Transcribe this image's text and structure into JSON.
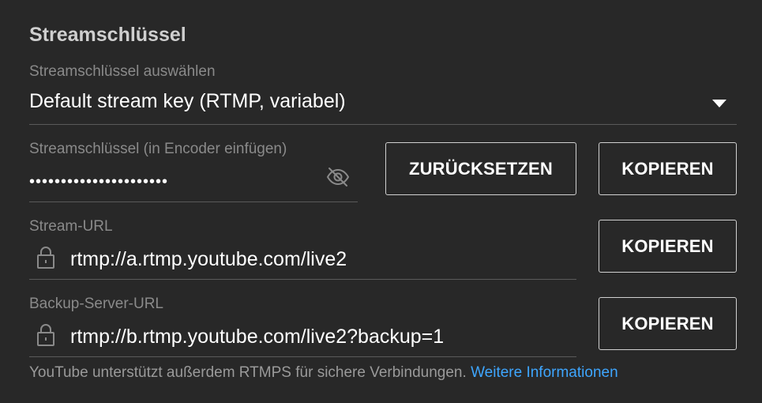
{
  "section": {
    "title": "Streamschlüssel"
  },
  "key_select": {
    "label": "Streamschlüssel auswählen",
    "value": "Default stream key (RTMP, variabel)",
    "dropdown_icon": "caret-down-icon"
  },
  "stream_key": {
    "label": "Streamschlüssel (in Encoder einfügen)",
    "masked_value": "••••••••••••••••••••••",
    "visibility_icon": "eye-off-icon",
    "reset_label": "ZURÜCKSETZEN",
    "copy_label": "KOPIEREN"
  },
  "stream_url": {
    "label": "Stream-URL",
    "value": "rtmp://a.rtmp.youtube.com/live2",
    "lock_icon": "lock-icon",
    "copy_label": "KOPIEREN"
  },
  "backup_url": {
    "label": "Backup-Server-URL",
    "value": "rtmp://b.rtmp.youtube.com/live2?backup=1",
    "lock_icon": "lock-icon",
    "copy_label": "KOPIEREN"
  },
  "footer": {
    "text": "YouTube unterstützt außerdem RTMPS für sichere Verbindungen.",
    "link": "Weitere Informationen"
  },
  "colors": {
    "background": "#282828",
    "link": "#3ea6ff",
    "label": "#8a8a8a"
  }
}
